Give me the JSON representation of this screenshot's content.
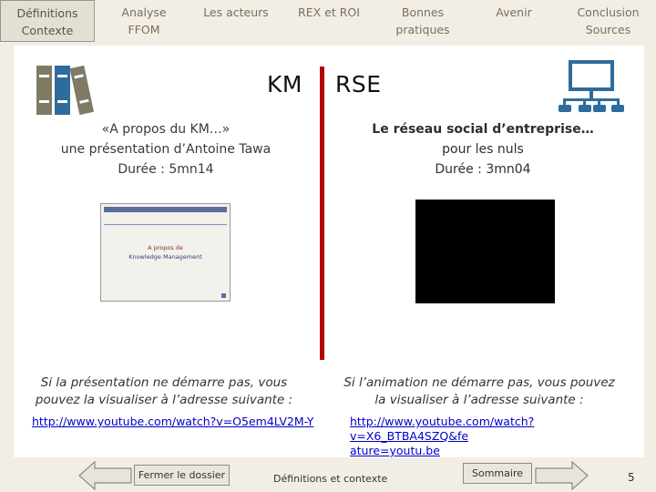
{
  "nav": {
    "tabs": [
      {
        "label": "Définitions Contexte"
      },
      {
        "label": "Analyse FFOM"
      },
      {
        "label": "Les acteurs"
      },
      {
        "label": "REX et ROI"
      },
      {
        "label": "Bonnes pratiques"
      },
      {
        "label": "Avenir"
      },
      {
        "label": "Conclusion Sources"
      }
    ]
  },
  "colors": {
    "accent_divider": "#b40000",
    "icon_books": "#7f7a63",
    "icon_books_blue": "#2e6c9e",
    "icon_network": "#2e6c9e",
    "link": "#0000cc"
  },
  "icons": {
    "left": "books-icon",
    "right": "network-icon"
  },
  "main": {
    "left": {
      "heading": "KM",
      "line1": "«A propos du KM…»",
      "line2": "une présentation d’Antoine Tawa",
      "line3": "Durée : 5mn14",
      "thumbnail": {
        "line1": "A propos de",
        "line2": "Knowledge Management"
      },
      "note1": "Si la présentation ne démarre pas, vous",
      "note2": "pouvez la visualiser à l’adresse suivante :",
      "link": "http://www.youtube.com/watch?v=O5em4LV2M-Y"
    },
    "right": {
      "heading": "RSE",
      "line1": "Le réseau social d’entreprise…",
      "line2": "pour les nuls",
      "line3": "Durée : 3mn04",
      "note1": "Si l’animation ne démarre pas, vous pouvez",
      "note2": "la visualiser à l’adresse suivante :",
      "link_line1": "http://www.youtube.com/watch?v=X6_BTBA4SZQ&fe",
      "link_line2": "ature=youtu.be"
    }
  },
  "footer": {
    "close_label": "Fermer le dossier",
    "section_label": "Définitions et contexte",
    "summary_label": "Sommaire",
    "page_number": "5"
  }
}
